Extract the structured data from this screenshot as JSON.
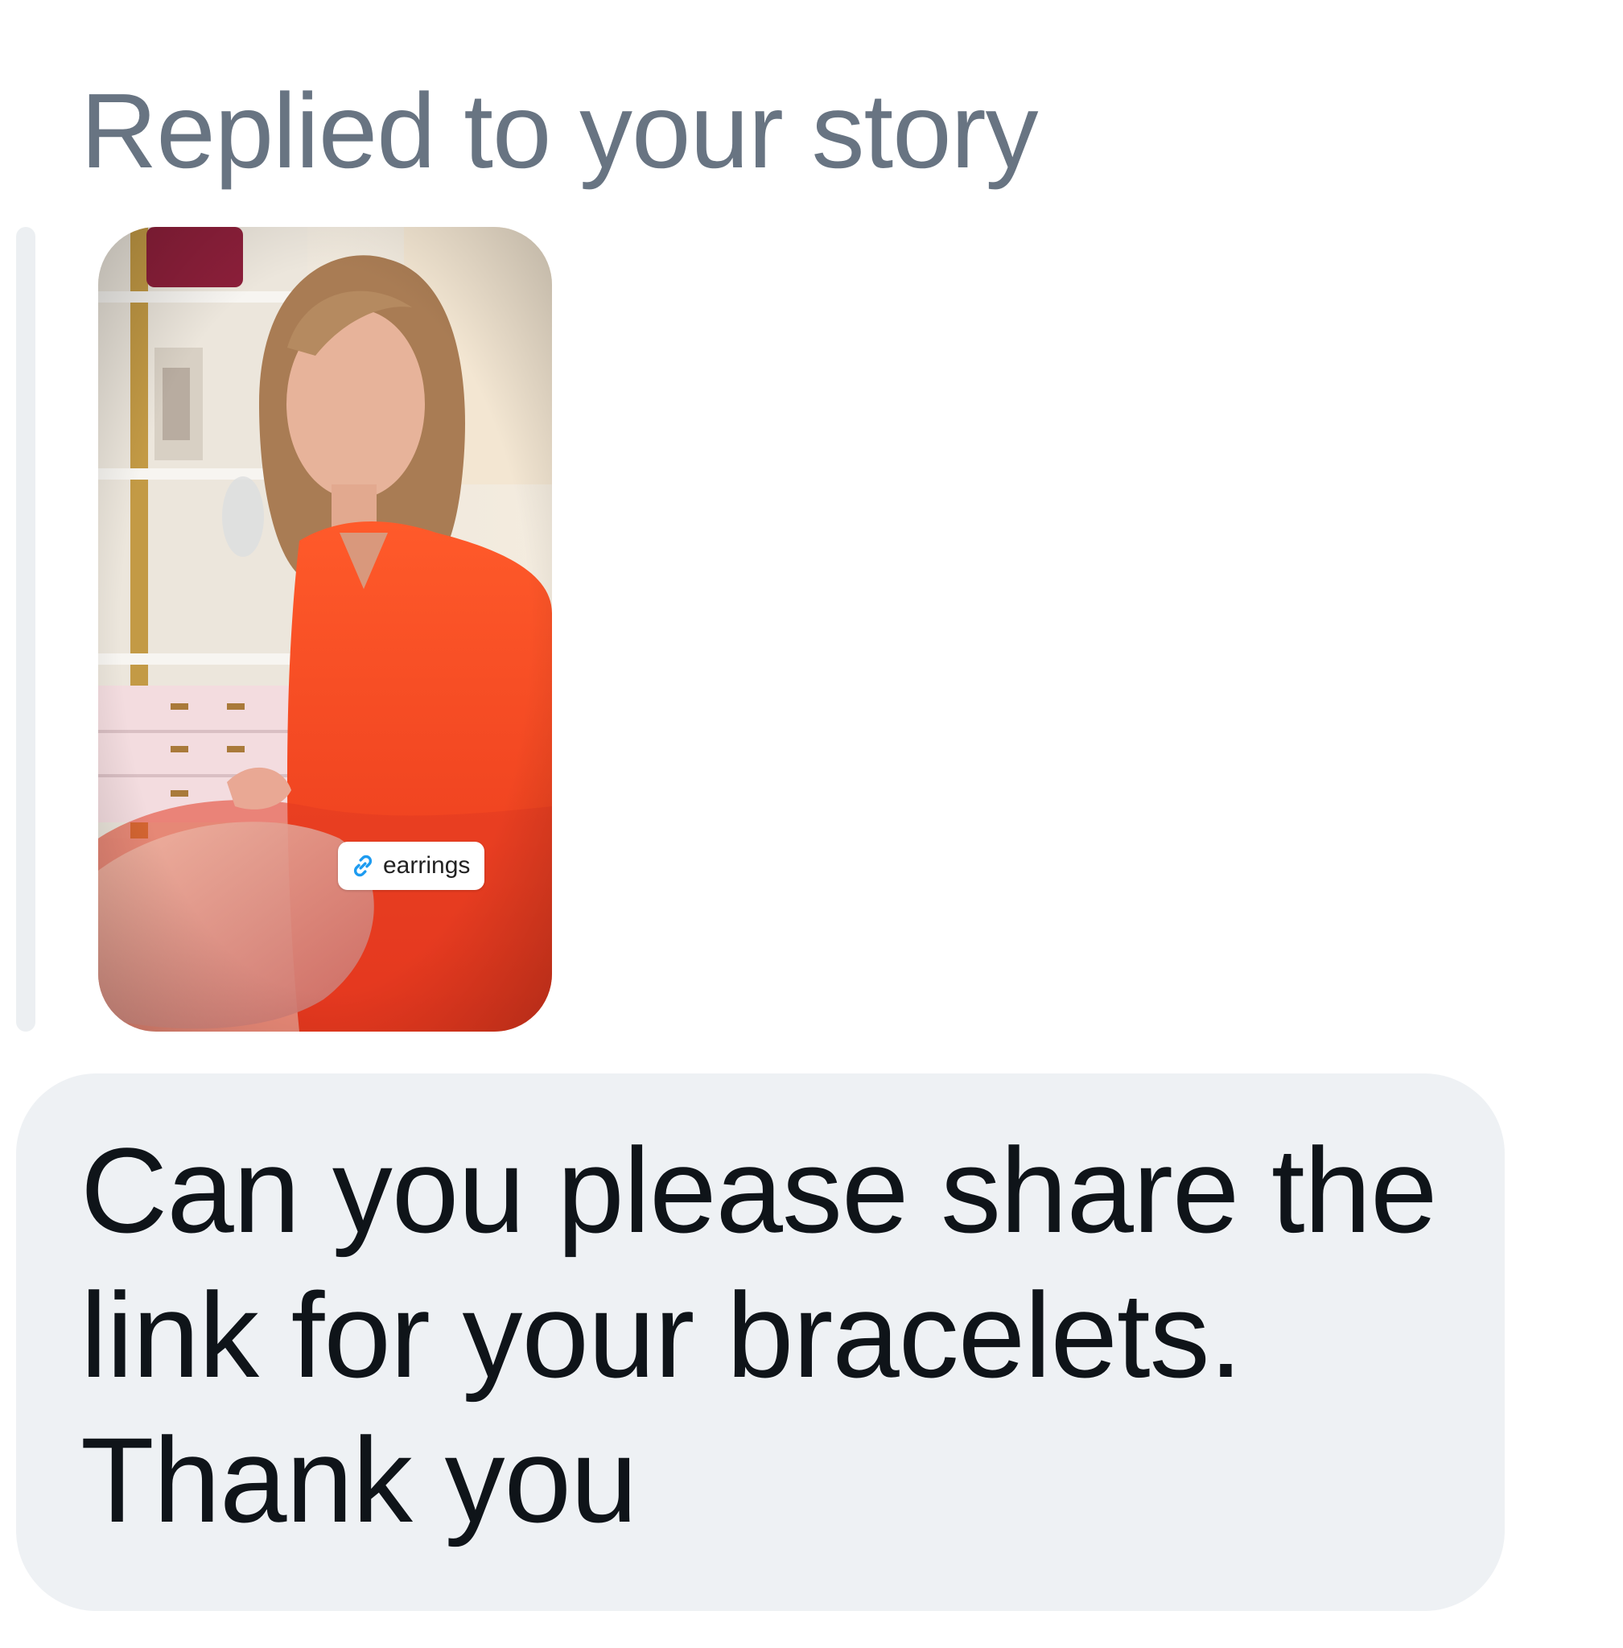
{
  "conversation": {
    "reply_context": "Replied to your story",
    "story": {
      "link_sticker": {
        "icon": "link-icon",
        "label": "earrings"
      }
    },
    "message": {
      "text": "Can you please share the link for your bracelets. Thank you"
    }
  },
  "colors": {
    "header_text": "#687482",
    "bubble_background": "#eef1f4",
    "message_text": "#0f1419",
    "quote_bar": "#eceff2",
    "link_icon": "#1d9bf0"
  }
}
